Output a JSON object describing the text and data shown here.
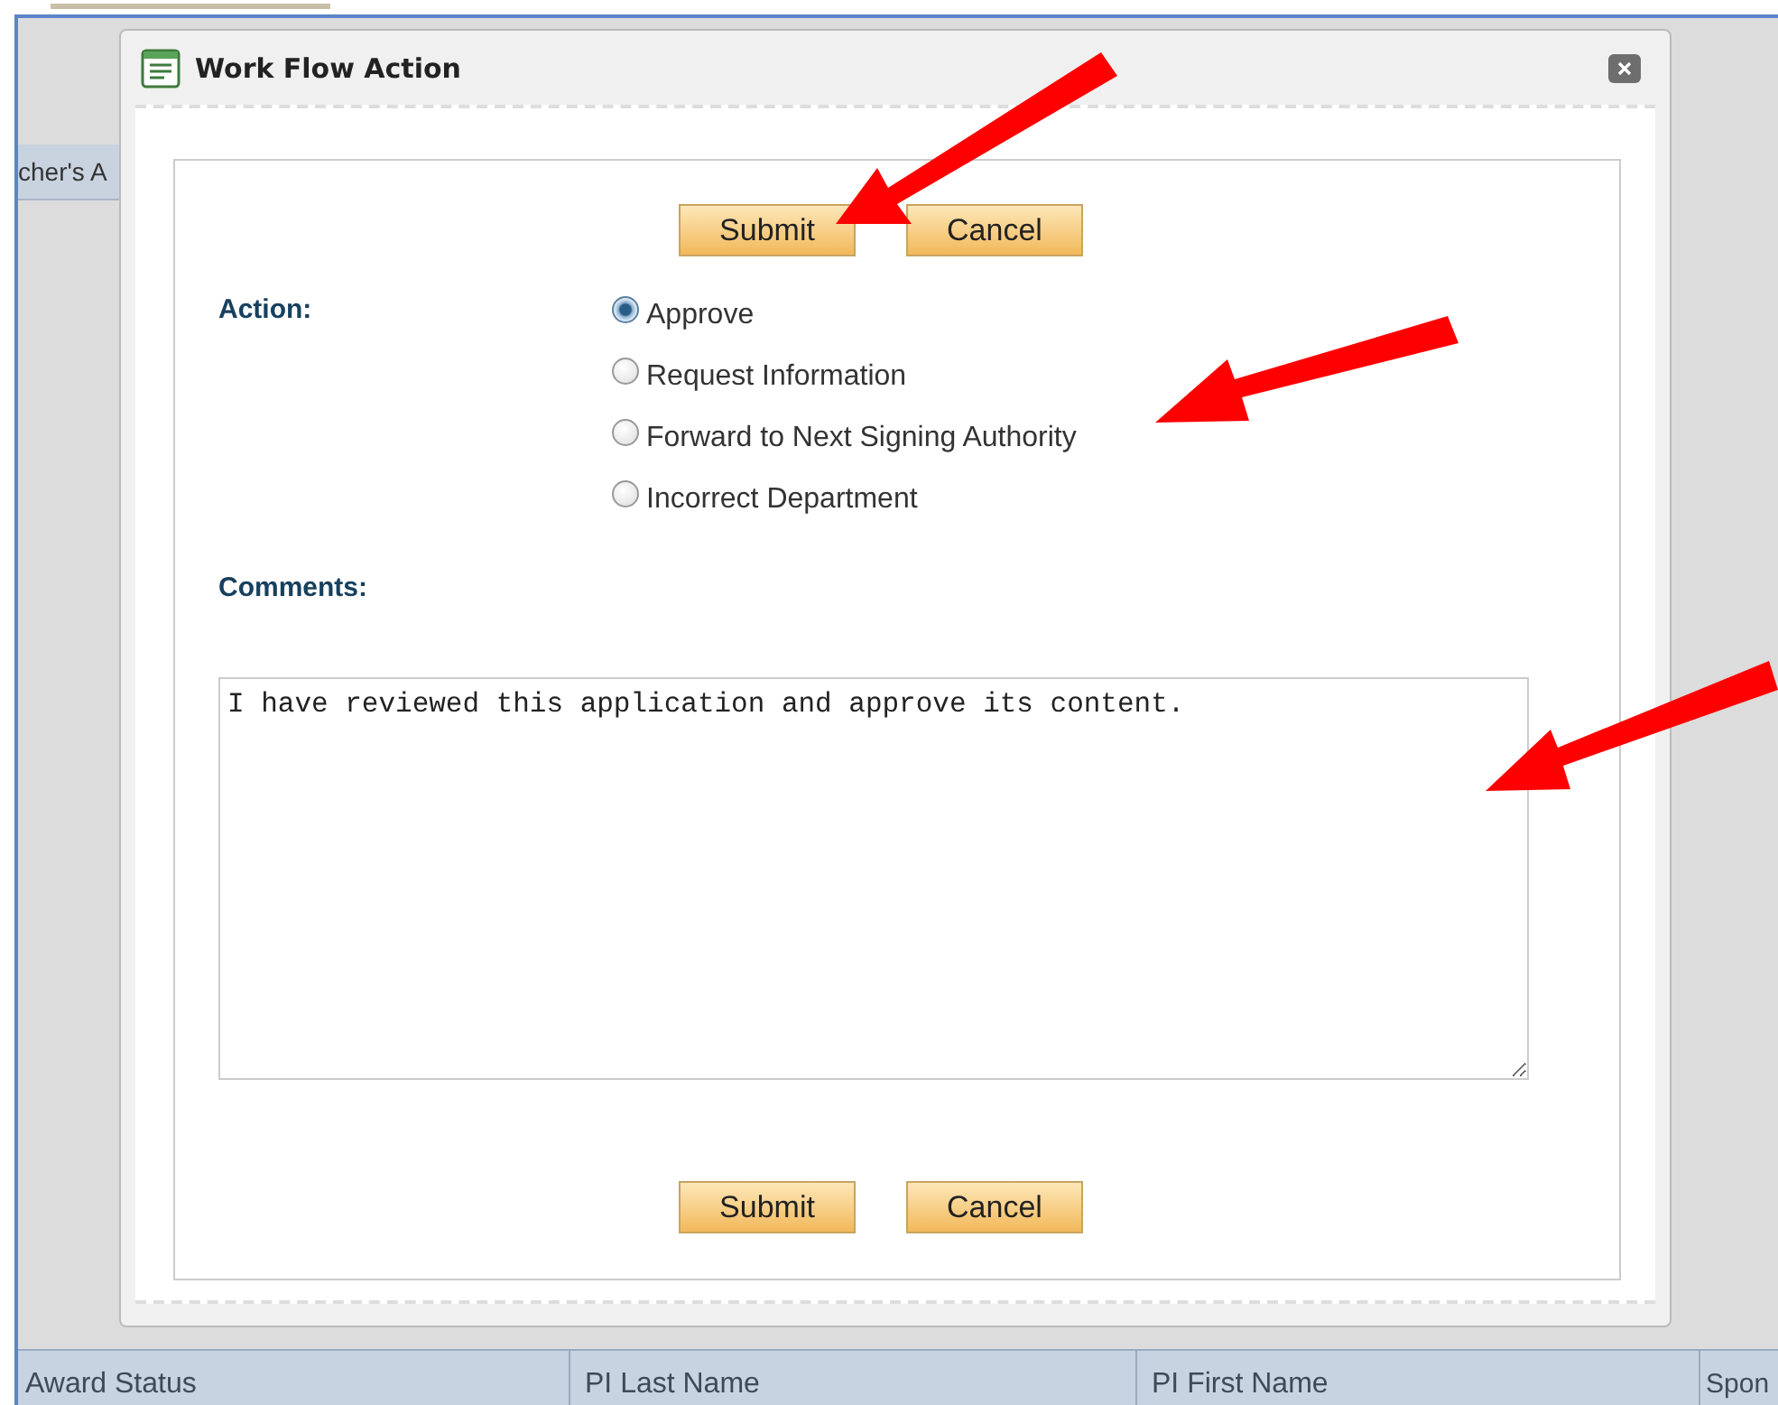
{
  "background": {
    "tab_label": "cher's A",
    "table": {
      "columns": [
        "Award Status",
        "PI Last Name",
        "PI First Name",
        "Spon"
      ]
    }
  },
  "dialog": {
    "title": "Work Flow Action",
    "top_buttons": [
      "Submit",
      "Cancel"
    ],
    "action_label": "Action:",
    "options": [
      {
        "label": "Approve",
        "selected": true
      },
      {
        "label": "Request Information",
        "selected": false
      },
      {
        "label": "Forward to Next Signing Authority",
        "selected": false
      },
      {
        "label": "Incorrect Department",
        "selected": false
      }
    ],
    "comments_label": "Comments:",
    "comments_value": "I have reviewed this application and approve its content.",
    "bottom_buttons": [
      "Submit",
      "Cancel"
    ]
  }
}
